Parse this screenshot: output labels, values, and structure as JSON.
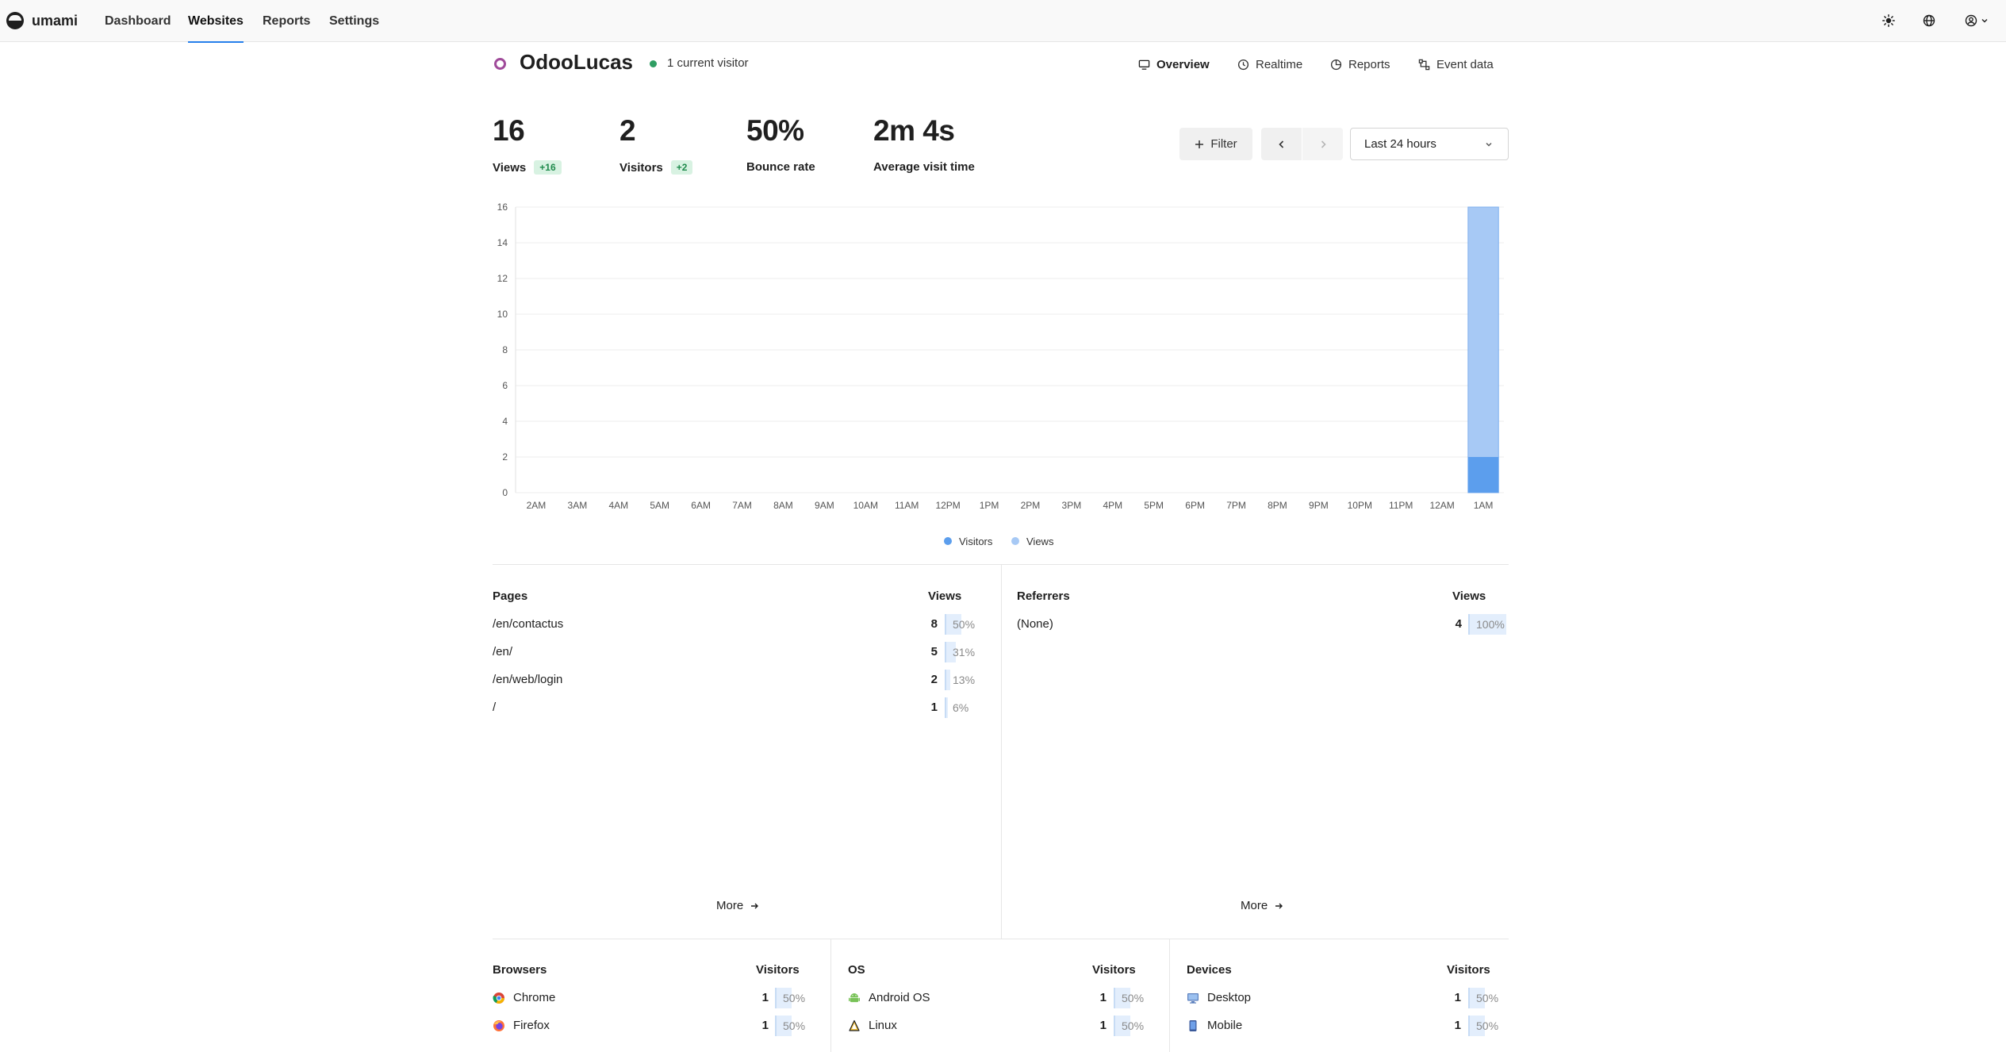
{
  "app": {
    "name": "umami"
  },
  "nav": {
    "items": [
      {
        "label": "Dashboard",
        "active": false
      },
      {
        "label": "Websites",
        "active": true
      },
      {
        "label": "Reports",
        "active": false
      },
      {
        "label": "Settings",
        "active": false
      }
    ],
    "right_icons": [
      "sun-icon",
      "globe-icon",
      "user-icon"
    ]
  },
  "website": {
    "name": "OdooLucas",
    "live_text": "1 current visitor",
    "tabs": [
      {
        "label": "Overview",
        "icon": "monitor-icon",
        "active": true
      },
      {
        "label": "Realtime",
        "icon": "clock-icon",
        "active": false
      },
      {
        "label": "Reports",
        "icon": "pie-icon",
        "active": false
      },
      {
        "label": "Event data",
        "icon": "nodes-icon",
        "active": false
      }
    ]
  },
  "metrics": [
    {
      "value": "16",
      "label": "Views",
      "change": "+16"
    },
    {
      "value": "2",
      "label": "Visitors",
      "change": "+2"
    },
    {
      "value": "50%",
      "label": "Bounce rate",
      "change": ""
    },
    {
      "value": "2m 4s",
      "label": "Average visit time",
      "change": ""
    }
  ],
  "controls": {
    "filter_label": "Filter",
    "date_range": "Last 24 hours"
  },
  "colors": {
    "visitors": "#5c9eed",
    "views": "#a7c9f5",
    "badge_bg": "#d8f2e2",
    "badge_text": "#1f8a4c",
    "active_nav": "#2680eb"
  },
  "chart_data": {
    "type": "bar",
    "stacked": true,
    "categories": [
      "2AM",
      "3AM",
      "4AM",
      "5AM",
      "6AM",
      "7AM",
      "8AM",
      "9AM",
      "10AM",
      "11AM",
      "12PM",
      "1PM",
      "2PM",
      "3PM",
      "4PM",
      "5PM",
      "6PM",
      "7PM",
      "8PM",
      "9PM",
      "10PM",
      "11PM",
      "12AM",
      "1AM"
    ],
    "series": [
      {
        "name": "Visitors",
        "values": [
          0,
          0,
          0,
          0,
          0,
          0,
          0,
          0,
          0,
          0,
          0,
          0,
          0,
          0,
          0,
          0,
          0,
          0,
          0,
          0,
          0,
          0,
          0,
          2
        ]
      },
      {
        "name": "Views",
        "values": [
          0,
          0,
          0,
          0,
          0,
          0,
          0,
          0,
          0,
          0,
          0,
          0,
          0,
          0,
          0,
          0,
          0,
          0,
          0,
          0,
          0,
          0,
          0,
          16
        ]
      }
    ],
    "yticks": [
      0,
      2,
      4,
      6,
      8,
      10,
      12,
      14,
      16
    ],
    "ylim": [
      0,
      16
    ],
    "grid": true,
    "legend": "bottom-center"
  },
  "pages": {
    "title": "Pages",
    "metric": "Views",
    "rows": [
      {
        "label": "/en/contactus",
        "value": "8",
        "pct": "50%",
        "share": 50
      },
      {
        "label": "/en/",
        "value": "5",
        "pct": "31%",
        "share": 31
      },
      {
        "label": "/en/web/login",
        "value": "2",
        "pct": "13%",
        "share": 13
      },
      {
        "label": "/",
        "value": "1",
        "pct": "6%",
        "share": 6
      }
    ],
    "more": "More"
  },
  "referrers": {
    "title": "Referrers",
    "metric": "Views",
    "rows": [
      {
        "label": "(None)",
        "value": "4",
        "pct": "100%",
        "share": 100
      }
    ],
    "more": "More"
  },
  "browsers": {
    "title": "Browsers",
    "metric": "Visitors",
    "rows": [
      {
        "label": "Chrome",
        "icon": "chrome-icon",
        "value": "1",
        "pct": "50%",
        "share": 50
      },
      {
        "label": "Firefox",
        "icon": "firefox-icon",
        "value": "1",
        "pct": "50%",
        "share": 50
      }
    ]
  },
  "os": {
    "title": "OS",
    "metric": "Visitors",
    "rows": [
      {
        "label": "Android OS",
        "icon": "android-icon",
        "value": "1",
        "pct": "50%",
        "share": 50
      },
      {
        "label": "Linux",
        "icon": "linux-icon",
        "value": "1",
        "pct": "50%",
        "share": 50
      }
    ]
  },
  "devices": {
    "title": "Devices",
    "metric": "Visitors",
    "rows": [
      {
        "label": "Desktop",
        "icon": "desktop-icon",
        "value": "1",
        "pct": "50%",
        "share": 50
      },
      {
        "label": "Mobile",
        "icon": "mobile-icon",
        "value": "1",
        "pct": "50%",
        "share": 50
      }
    ]
  }
}
